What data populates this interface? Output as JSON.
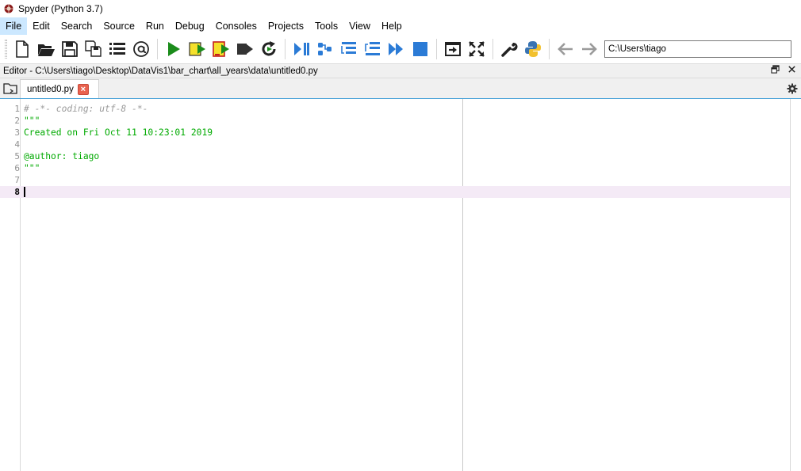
{
  "window": {
    "title": "Spyder (Python 3.7)"
  },
  "menu": [
    {
      "label": "File",
      "active": true
    },
    {
      "label": "Edit"
    },
    {
      "label": "Search"
    },
    {
      "label": "Source"
    },
    {
      "label": "Run"
    },
    {
      "label": "Debug"
    },
    {
      "label": "Consoles"
    },
    {
      "label": "Projects"
    },
    {
      "label": "Tools"
    },
    {
      "label": "View"
    },
    {
      "label": "Help"
    }
  ],
  "toolbar": {
    "icons": [
      "new-file-icon",
      "open-file-icon",
      "save-icon",
      "save-all-icon",
      "outline-icon",
      "at-icon",
      "run-icon",
      "run-cell-icon",
      "run-cell-advance-icon",
      "run-selection-icon",
      "rerun-icon",
      "debug-icon",
      "debug-step-icon",
      "debug-step-into-icon",
      "debug-step-return-icon",
      "debug-continue-icon",
      "debug-stop-icon",
      "maximize-pane-icon",
      "fullscreen-icon",
      "preferences-icon",
      "python-path-icon",
      "back-icon",
      "forward-icon"
    ],
    "working_dir": "C:\\Users\\tiago"
  },
  "editor": {
    "header": "Editor - C:\\Users\\tiago\\Desktop\\DataVis1\\bar_chart\\all_years\\data\\untitled0.py",
    "tab_label": "untitled0.py",
    "tab_close": "×",
    "current_line": 8,
    "lines": [
      {
        "n": "1",
        "text": "# -*- coding: utf-8 -*-",
        "kind": "comment"
      },
      {
        "n": "2",
        "text": "\"\"\"",
        "kind": "string"
      },
      {
        "n": "3",
        "text": "Created on Fri Oct 11 10:23:01 2019",
        "kind": "string"
      },
      {
        "n": "4",
        "text": "",
        "kind": "string"
      },
      {
        "n": "5",
        "text": "@author: tiago",
        "kind": "string"
      },
      {
        "n": "6",
        "text": "\"\"\"",
        "kind": "string"
      },
      {
        "n": "7",
        "text": "",
        "kind": "plain"
      },
      {
        "n": "8",
        "text": "",
        "kind": "plain"
      }
    ]
  },
  "colors": {
    "string": "#00aa00",
    "comment": "#9a9a9a",
    "current_line": "#f4eaf6",
    "run_green": "#1b8c1b",
    "debug_blue": "#2b7bd6"
  }
}
